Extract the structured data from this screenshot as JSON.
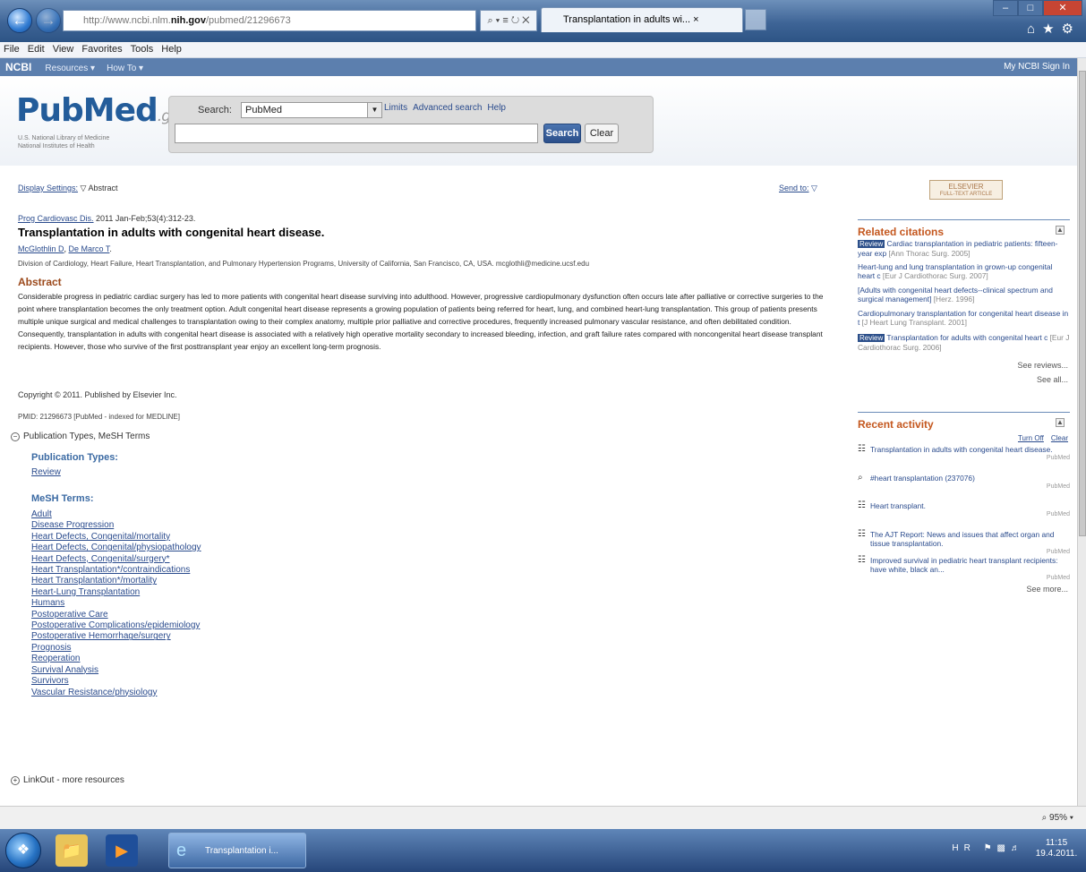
{
  "browser": {
    "url_prefix": "http://www.ncbi.nlm.",
    "url_domain": "nih.gov",
    "url_path": "/pubmed/21296673",
    "addr_controls": "⌕ ▾ ≡ ↻ ✕",
    "tab_title": "Transplantation in adults wi...",
    "tab_close": "×"
  },
  "menu": [
    "File",
    "Edit",
    "View",
    "Favorites",
    "Tools",
    "Help"
  ],
  "ncbi": {
    "logo": "NCBI",
    "resources": "Resources",
    "howto": "How To",
    "signin": "My NCBI  Sign In"
  },
  "pubmed": {
    "logo": "PubMed",
    "gov": ".gov",
    "sub1": "U.S. National Library of Medicine",
    "sub2": "National Institutes of Health",
    "search_label": "Search:",
    "db": "PubMed",
    "limits": "Limits",
    "advanced": "Advanced search",
    "help": "Help",
    "search_btn": "Search",
    "clear_btn": "Clear"
  },
  "article": {
    "display_settings": "Display Settings:",
    "abstract_mode": "Abstract",
    "send_to": "Send to:",
    "journal": "Prog Cardiovasc Dis.",
    "citation": " 2011 Jan-Feb;53(4):312-23.",
    "title": "Transplantation in adults with congenital heart disease.",
    "author1": "McGlothlin D",
    "author2": "De Marco T",
    "affiliation": "Division of Cardiology, Heart Failure, Heart Transplantation, and Pulmonary Hypertension Programs, University of California, San Francisco, CA, USA. mcglothli@medicine.ucsf.edu",
    "abstract_head": "Abstract",
    "abstract": "Considerable progress in pediatric cardiac surgery has led to more patients with congenital heart disease surviving into adulthood. However, progressive cardiopulmonary dysfunction often occurs late after palliative or corrective surgeries to the point where transplantation becomes the only treatment option. Adult congenital heart disease represents a growing population of patients being referred for heart, lung, and combined heart-lung transplantation. This group of patients presents multiple unique surgical and medical challenges to transplantation owing to their complex anatomy, multiple prior palliative and corrective procedures, frequently increased pulmonary vascular resistance, and often debilitated condition. Consequently, transplantation in adults with congenital heart disease is associated with a relatively high operative mortality secondary to increased bleeding, infection, and graft failure rates compared with noncongenital heart disease transplant recipients. However, those who survive of the first posttransplant year enjoy an excellent long-term prognosis.",
    "copyright": "Copyright © 2011. Published by Elsevier Inc.",
    "pmid": "PMID: 21296673 [PubMed - indexed for MEDLINE]",
    "pubtypes_toggle": "Publication Types, MeSH Terms",
    "pubtypes_head": "Publication Types:",
    "pubtype": "Review",
    "mesh_head": "MeSH Terms:",
    "mesh": [
      "Adult",
      "Disease Progression",
      "Heart Defects, Congenital/mortality",
      "Heart Defects, Congenital/physiopathology",
      "Heart Defects, Congenital/surgery*",
      "Heart Transplantation*/contraindications",
      "Heart Transplantation*/mortality",
      "Heart-Lung Transplantation",
      "Humans",
      "Postoperative Care",
      "Postoperative Complications/epidemiology",
      "Postoperative Hemorrhage/surgery",
      "Prognosis",
      "Reoperation",
      "Survival Analysis",
      "Survivors",
      "Vascular Resistance/physiology"
    ],
    "linkout": "LinkOut - more resources"
  },
  "sidebar": {
    "elsevier": "ELSEVIER",
    "elsevier_sub": "FULL-TEXT ARTICLE",
    "related_head": "Related citations",
    "review_badge": "Review",
    "c1": " Cardiac transplantation in pediatric patients: fifteen-year exp",
    "c1src": " [Ann Thorac Surg. 2005]",
    "c2": "Heart-lung and lung transplantation in grown-up congenital heart c",
    "c2src": " [Eur J Cardiothorac Surg. 2007]",
    "c3": "[Adults with congenital heart defects--clinical spectrum and surgical management]",
    "c3src": " [Herz. 1996]",
    "c4": "Cardiopulmonary transplantation for congenital heart disease in t",
    "c4src": " [J Heart Lung Transplant. 2001]",
    "c5": " Transplantation for adults with congenital heart c",
    "c5src": " [Eur J Cardiothorac Surg. 2006]",
    "see_reviews": "See reviews...",
    "see_all": "See all...",
    "recent_head": "Recent activity",
    "turn_off": "Turn Off",
    "clear": "Clear",
    "ra": [
      {
        "text": "Transplantation in adults with congenital heart disease.",
        "db": "PubMed",
        "icon": "☷"
      },
      {
        "text": "#heart transplantation (237076)",
        "db": "PubMed",
        "icon": "⌕"
      },
      {
        "text": "Heart transplant.",
        "db": "PubMed",
        "icon": "☷"
      },
      {
        "text": "The AJT Report: News and issues that affect organ and tissue transplantation.",
        "db": "PubMed",
        "icon": "☷"
      },
      {
        "text": "Improved survival in pediatric heart transplant recipients: have white, black an...",
        "db": "PubMed",
        "icon": "☷"
      }
    ],
    "see_more": "See more..."
  },
  "status": {
    "zoom": "⌕ 95%  ▾"
  },
  "taskbar": {
    "task": "Transplantation i...",
    "lang": "HR",
    "time": "11:15",
    "date": "19.4.2011."
  }
}
